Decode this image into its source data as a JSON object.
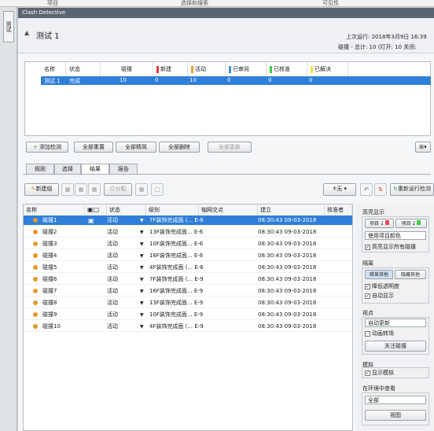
{
  "ribbon": {
    "items": [
      "项目",
      "选择和搜索",
      "可见性"
    ]
  },
  "side_tab": "测试",
  "window_title": "Clash Detective",
  "test": {
    "name": "测试 1",
    "last_run_label": "上次运行: 2018年3月9日 16:39",
    "summary": "碰撞 - 总计: 10 (打开: 10 关闭:"
  },
  "test_grid": {
    "headers": [
      "名称",
      "状态",
      "碰撞",
      "新建",
      "活动",
      "已审阅",
      "已核准",
      "已解决"
    ],
    "header_colors": [
      "",
      "",
      "",
      "#e23a3a",
      "#f0a030",
      "#3a8fe8",
      "#40c840",
      "#f0e040"
    ],
    "row": [
      "测试 1",
      "完成",
      "10",
      "0",
      "10",
      "0",
      "0",
      "0"
    ]
  },
  "test_buttons": {
    "add": "添加检测",
    "reset_all": "全部重置",
    "compact_all": "全部精简",
    "delete_all": "全部删除",
    "update_all": "全部更新"
  },
  "tabs": [
    "规则",
    "选择",
    "结果",
    "报告"
  ],
  "active_tab": "结果",
  "results_toolbar": {
    "new_group": "新建组",
    "assign": "分配",
    "none_label": "无",
    "rerun": "重新运行检测"
  },
  "results_grid": {
    "headers": [
      "名称",
      "状态",
      "级别",
      "轴网交点",
      "建立",
      "核准者"
    ],
    "rows": [
      {
        "name": "碰撞1",
        "status": "活动",
        "level": "7F装饰完成面 (... E-6",
        "created": "08:30:43 09-03-2018",
        "selected": true
      },
      {
        "name": "碰撞2",
        "status": "活动",
        "level": "13F装饰完成面... E-6",
        "created": "08:30:43 09-03-2018"
      },
      {
        "name": "碰撞3",
        "status": "活动",
        "level": "10F装饰完成面... E-6",
        "created": "08:30:43 09-03-2018"
      },
      {
        "name": "碰撞4",
        "status": "活动",
        "level": "16F装饰完成面... E-6",
        "created": "08:30:43 09-03-2018"
      },
      {
        "name": "碰撞5",
        "status": "活动",
        "level": "4F装饰完成面 (... E-6",
        "created": "08:30:43 09-03-2018"
      },
      {
        "name": "碰撞6",
        "status": "活动",
        "level": "7F装饰完成面 (... E-9",
        "created": "08:30:43 09-03-2018"
      },
      {
        "name": "碰撞7",
        "status": "活动",
        "level": "16F装饰完成面... E-9",
        "created": "08:30:43 09-03-2018"
      },
      {
        "name": "碰撞8",
        "status": "活动",
        "level": "13F装饰完成面... E-9",
        "created": "08:30:43 09-03-2018"
      },
      {
        "name": "碰撞9",
        "status": "活动",
        "level": "10F装饰完成面... E-9",
        "created": "08:30:43 09-03-2018"
      },
      {
        "name": "碰撞10",
        "status": "活动",
        "level": "4F装饰完成面 (... E-9",
        "created": "08:30:43 09-03-2018"
      }
    ]
  },
  "right_panel": {
    "highlight": "高亮显示",
    "item1": "项目 1",
    "item2": "项目 2",
    "use_color": "使用项目颜色",
    "highlight_all": "高亮显示所有碰撞",
    "isolate": "隔离",
    "dim_others": "暗显其他",
    "hide_others": "隐藏其他",
    "reduce_transparency": "降低透明度",
    "auto_show": "自动显示",
    "viewpoint": "视点",
    "auto_update": "自动更新",
    "animate": "动画转场",
    "focus": "关注碰撞",
    "simulation": "模拟",
    "show_sim": "显示模拟",
    "env_view": "在环境中查看",
    "all": "全部",
    "view": "视图"
  }
}
